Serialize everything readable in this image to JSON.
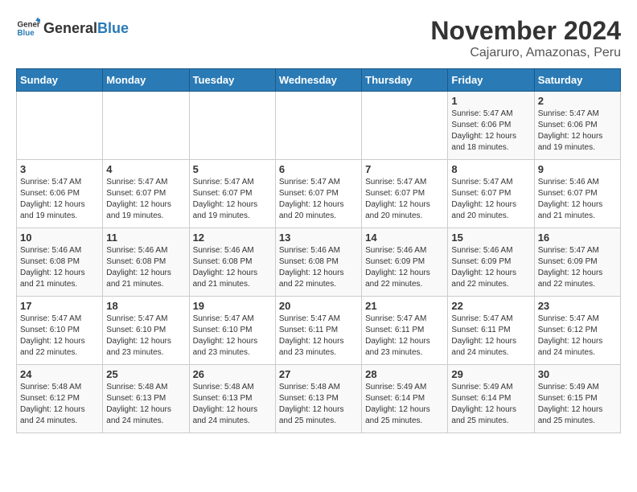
{
  "logo": {
    "text_general": "General",
    "text_blue": "Blue"
  },
  "title": "November 2024",
  "subtitle": "Cajaruro, Amazonas, Peru",
  "days_of_week": [
    "Sunday",
    "Monday",
    "Tuesday",
    "Wednesday",
    "Thursday",
    "Friday",
    "Saturday"
  ],
  "weeks": [
    [
      {
        "day": "",
        "info": ""
      },
      {
        "day": "",
        "info": ""
      },
      {
        "day": "",
        "info": ""
      },
      {
        "day": "",
        "info": ""
      },
      {
        "day": "",
        "info": ""
      },
      {
        "day": "1",
        "info": "Sunrise: 5:47 AM\nSunset: 6:06 PM\nDaylight: 12 hours and 18 minutes."
      },
      {
        "day": "2",
        "info": "Sunrise: 5:47 AM\nSunset: 6:06 PM\nDaylight: 12 hours and 19 minutes."
      }
    ],
    [
      {
        "day": "3",
        "info": "Sunrise: 5:47 AM\nSunset: 6:06 PM\nDaylight: 12 hours and 19 minutes."
      },
      {
        "day": "4",
        "info": "Sunrise: 5:47 AM\nSunset: 6:07 PM\nDaylight: 12 hours and 19 minutes."
      },
      {
        "day": "5",
        "info": "Sunrise: 5:47 AM\nSunset: 6:07 PM\nDaylight: 12 hours and 19 minutes."
      },
      {
        "day": "6",
        "info": "Sunrise: 5:47 AM\nSunset: 6:07 PM\nDaylight: 12 hours and 20 minutes."
      },
      {
        "day": "7",
        "info": "Sunrise: 5:47 AM\nSunset: 6:07 PM\nDaylight: 12 hours and 20 minutes."
      },
      {
        "day": "8",
        "info": "Sunrise: 5:47 AM\nSunset: 6:07 PM\nDaylight: 12 hours and 20 minutes."
      },
      {
        "day": "9",
        "info": "Sunrise: 5:46 AM\nSunset: 6:07 PM\nDaylight: 12 hours and 21 minutes."
      }
    ],
    [
      {
        "day": "10",
        "info": "Sunrise: 5:46 AM\nSunset: 6:08 PM\nDaylight: 12 hours and 21 minutes."
      },
      {
        "day": "11",
        "info": "Sunrise: 5:46 AM\nSunset: 6:08 PM\nDaylight: 12 hours and 21 minutes."
      },
      {
        "day": "12",
        "info": "Sunrise: 5:46 AM\nSunset: 6:08 PM\nDaylight: 12 hours and 21 minutes."
      },
      {
        "day": "13",
        "info": "Sunrise: 5:46 AM\nSunset: 6:08 PM\nDaylight: 12 hours and 22 minutes."
      },
      {
        "day": "14",
        "info": "Sunrise: 5:46 AM\nSunset: 6:09 PM\nDaylight: 12 hours and 22 minutes."
      },
      {
        "day": "15",
        "info": "Sunrise: 5:46 AM\nSunset: 6:09 PM\nDaylight: 12 hours and 22 minutes."
      },
      {
        "day": "16",
        "info": "Sunrise: 5:47 AM\nSunset: 6:09 PM\nDaylight: 12 hours and 22 minutes."
      }
    ],
    [
      {
        "day": "17",
        "info": "Sunrise: 5:47 AM\nSunset: 6:10 PM\nDaylight: 12 hours and 22 minutes."
      },
      {
        "day": "18",
        "info": "Sunrise: 5:47 AM\nSunset: 6:10 PM\nDaylight: 12 hours and 23 minutes."
      },
      {
        "day": "19",
        "info": "Sunrise: 5:47 AM\nSunset: 6:10 PM\nDaylight: 12 hours and 23 minutes."
      },
      {
        "day": "20",
        "info": "Sunrise: 5:47 AM\nSunset: 6:11 PM\nDaylight: 12 hours and 23 minutes."
      },
      {
        "day": "21",
        "info": "Sunrise: 5:47 AM\nSunset: 6:11 PM\nDaylight: 12 hours and 23 minutes."
      },
      {
        "day": "22",
        "info": "Sunrise: 5:47 AM\nSunset: 6:11 PM\nDaylight: 12 hours and 24 minutes."
      },
      {
        "day": "23",
        "info": "Sunrise: 5:47 AM\nSunset: 6:12 PM\nDaylight: 12 hours and 24 minutes."
      }
    ],
    [
      {
        "day": "24",
        "info": "Sunrise: 5:48 AM\nSunset: 6:12 PM\nDaylight: 12 hours and 24 minutes."
      },
      {
        "day": "25",
        "info": "Sunrise: 5:48 AM\nSunset: 6:13 PM\nDaylight: 12 hours and 24 minutes."
      },
      {
        "day": "26",
        "info": "Sunrise: 5:48 AM\nSunset: 6:13 PM\nDaylight: 12 hours and 24 minutes."
      },
      {
        "day": "27",
        "info": "Sunrise: 5:48 AM\nSunset: 6:13 PM\nDaylight: 12 hours and 25 minutes."
      },
      {
        "day": "28",
        "info": "Sunrise: 5:49 AM\nSunset: 6:14 PM\nDaylight: 12 hours and 25 minutes."
      },
      {
        "day": "29",
        "info": "Sunrise: 5:49 AM\nSunset: 6:14 PM\nDaylight: 12 hours and 25 minutes."
      },
      {
        "day": "30",
        "info": "Sunrise: 5:49 AM\nSunset: 6:15 PM\nDaylight: 12 hours and 25 minutes."
      }
    ]
  ]
}
